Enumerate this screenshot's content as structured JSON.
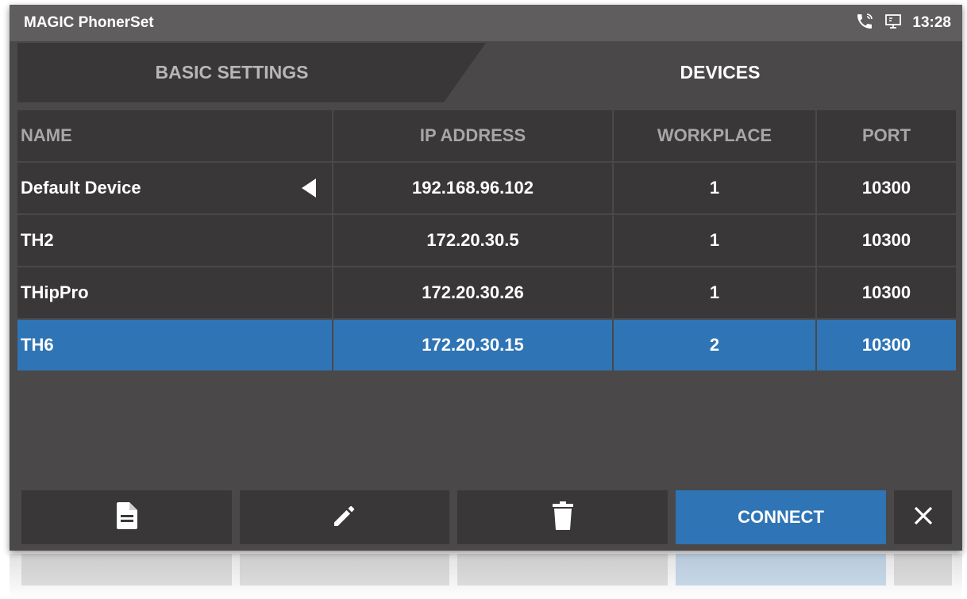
{
  "statusbar": {
    "app_title": "MAGIC PhonerSet",
    "time": "13:28",
    "icons": [
      "phone-call-icon",
      "monitor-icon"
    ]
  },
  "tabs": [
    {
      "label": "BASIC SETTINGS",
      "active": false
    },
    {
      "label": "DEVICES",
      "active": true
    }
  ],
  "table": {
    "headers": [
      "NAME",
      "IP ADDRESS",
      "WORKPLACE",
      "PORT"
    ],
    "rows": [
      {
        "name": "Default Device",
        "ip": "192.168.96.102",
        "workplace": "1",
        "port": "10300",
        "default": true,
        "selected": false
      },
      {
        "name": "TH2",
        "ip": "172.20.30.5",
        "workplace": "1",
        "port": "10300",
        "default": false,
        "selected": false
      },
      {
        "name": "THipPro",
        "ip": "172.20.30.26",
        "workplace": "1",
        "port": "10300",
        "default": false,
        "selected": false
      },
      {
        "name": "TH6",
        "ip": "172.20.30.15",
        "workplace": "2",
        "port": "10300",
        "default": false,
        "selected": true
      }
    ]
  },
  "toolbar": {
    "new_icon": "document-icon",
    "edit_icon": "pencil-icon",
    "delete_icon": "trash-icon",
    "connect_label": "CONNECT",
    "close_icon": "close-icon"
  },
  "colors": {
    "background": "#4a4849",
    "statusbar": "#5f5d5e",
    "cell": "#393738",
    "selected": "#2f74b5",
    "header_text": "#a8a6a6"
  }
}
